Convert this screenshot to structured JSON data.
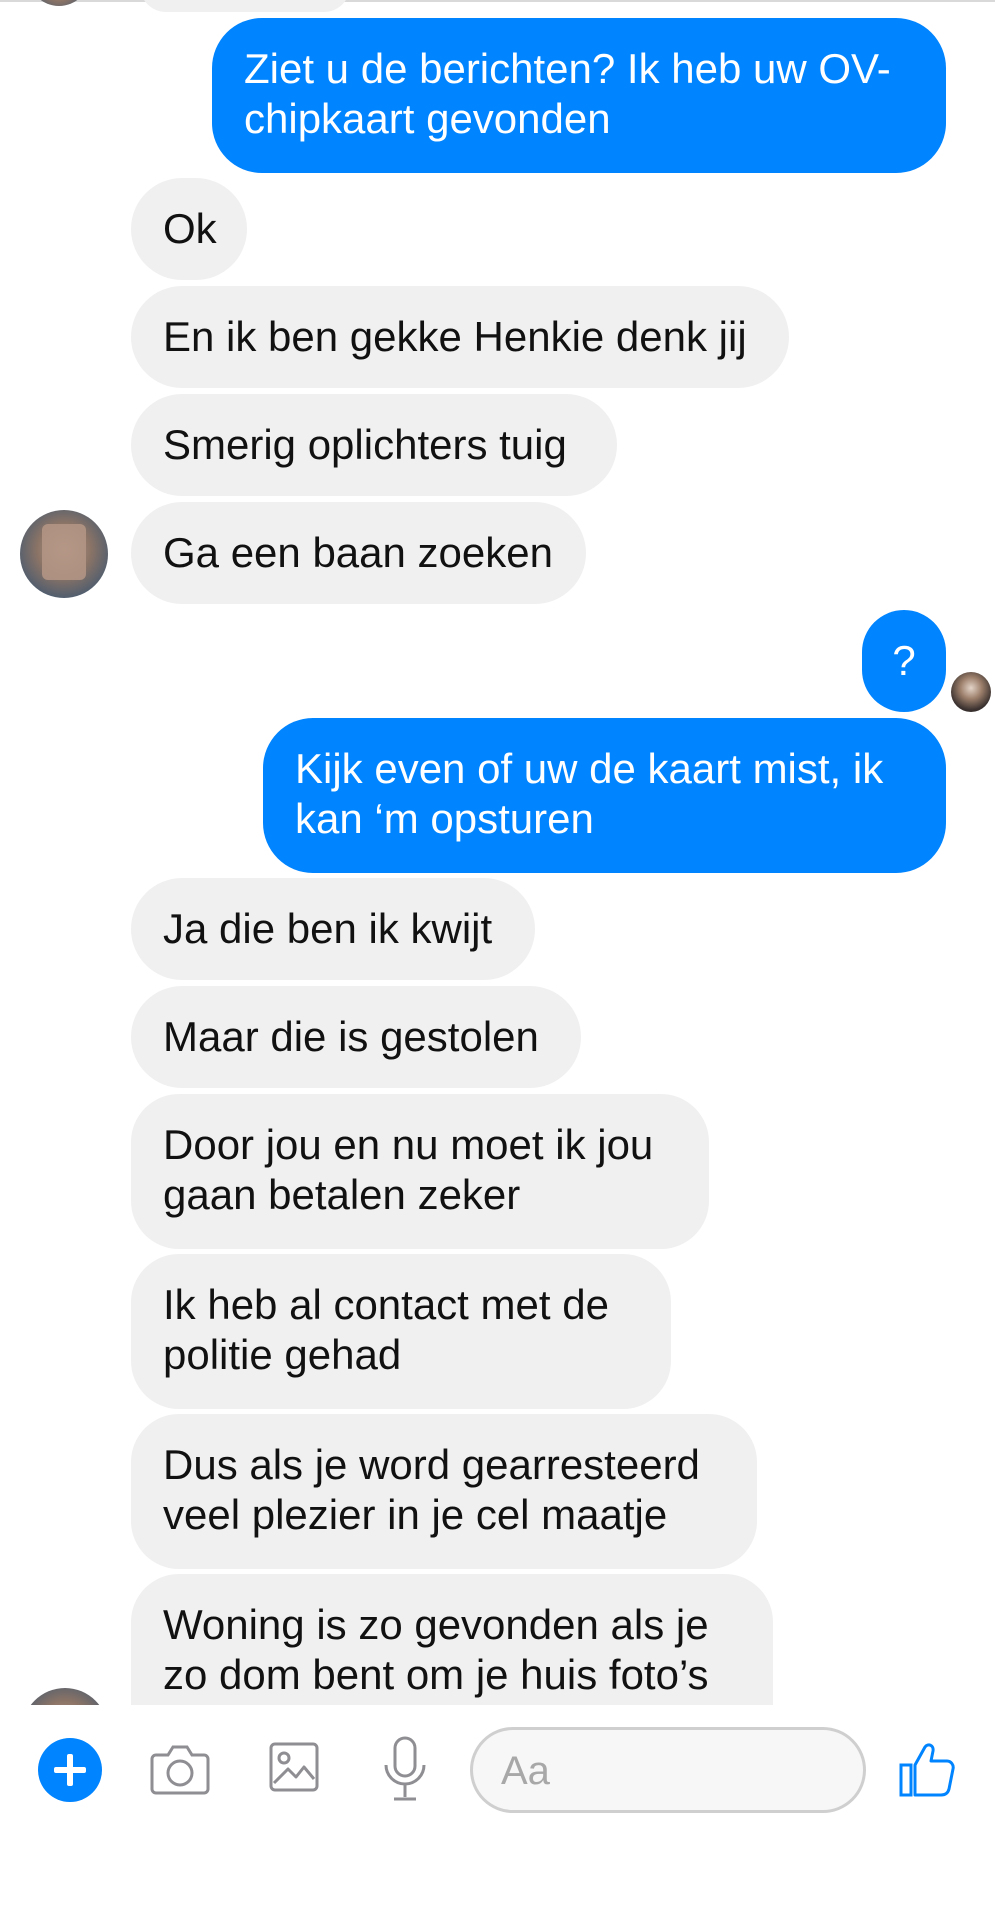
{
  "messages": [
    {
      "from": "me",
      "text": "Ziet u de berichten? Ik heb uw OV-chipkaart gevonden"
    },
    {
      "from": "them",
      "text": "Ok"
    },
    {
      "from": "them",
      "text": "En ik ben gekke Henkie denk jij"
    },
    {
      "from": "them",
      "text": "Smerig oplichters tuig"
    },
    {
      "from": "them",
      "text": "Ga een baan zoeken"
    },
    {
      "from": "me",
      "text": "?"
    },
    {
      "from": "me",
      "text": "Kijk even of uw de kaart mist, ik kan ‘m opsturen"
    },
    {
      "from": "them",
      "text": "Ja die ben ik kwijt"
    },
    {
      "from": "them",
      "text": "Maar die is gestolen"
    },
    {
      "from": "them",
      "text": "Door jou en nu moet ik jou gaan betalen zeker"
    },
    {
      "from": "them",
      "text": "Ik heb al contact met de politie gehad"
    },
    {
      "from": "them",
      "text": "Dus als je word gearresteerd veel plezier in je cel maatje"
    },
    {
      "from": "them",
      "text": "Woning is zo gevonden als je zo dom bent om je huis foto’s"
    }
  ],
  "composer": {
    "placeholder": "Aa",
    "icons": [
      "plus-icon",
      "camera-icon",
      "image-icon",
      "microphone-icon",
      "thumbs-up-icon"
    ]
  },
  "colors": {
    "outgoing": "#0084ff",
    "incoming": "#f0f0f0",
    "icon_blue": "#0084ff",
    "icon_grey": "#8e8e93"
  }
}
